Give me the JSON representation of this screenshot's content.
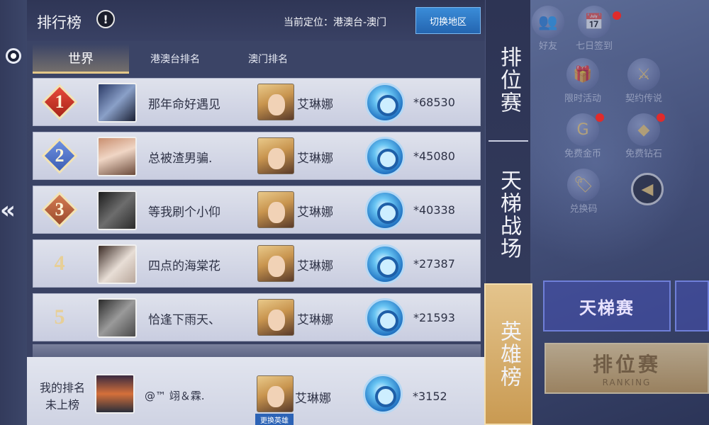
{
  "header": {
    "title": "排行榜",
    "location": "当前定位：港澳台-澳门",
    "switch_button": "切换地区"
  },
  "tabs": [
    {
      "label": "世界",
      "active": true
    },
    {
      "label": "港澳台排名",
      "active": false
    },
    {
      "label": "澳门排名",
      "active": false
    }
  ],
  "rankings": [
    {
      "rank": "1",
      "badge": "gold",
      "name": "那年命好遇见",
      "hero": "艾琳娜",
      "score": "*68530"
    },
    {
      "rank": "2",
      "badge": "silver",
      "name": "总被渣男骗.",
      "hero": "艾琳娜",
      "score": "*45080"
    },
    {
      "rank": "3",
      "badge": "bronze",
      "name": "等我刷个小仰",
      "hero": "艾琳娜",
      "score": "*40338"
    },
    {
      "rank": "4",
      "badge": "none",
      "name": "四点的海棠花",
      "hero": "艾琳娜",
      "score": "*27387"
    },
    {
      "rank": "5",
      "badge": "none",
      "name": "恰逢下雨天、",
      "hero": "艾琳娜",
      "score": "*21593"
    }
  ],
  "my_rank": {
    "label_line1": "我的排名",
    "label_line2": "未上榜",
    "name": "@™ 翊＆霖.",
    "hero": "艾琳娜",
    "score": "*3152",
    "change_hero": "更换英雄"
  },
  "side_tabs": [
    {
      "label": "排位赛",
      "active": false
    },
    {
      "label": "天梯战场",
      "active": false
    },
    {
      "label": "英雄榜",
      "active": true
    }
  ],
  "background_menu": {
    "friends": "好友",
    "checkin": "七日签到",
    "limited_event": "限时活动",
    "contract_legend": "契约传说",
    "free_gold": "免费金币",
    "free_diamond": "免费钻石",
    "redeem_code": "兑换码",
    "ladder_match": "天梯赛",
    "ranked_match": "排位赛",
    "ranked_sub": "RANKING"
  }
}
